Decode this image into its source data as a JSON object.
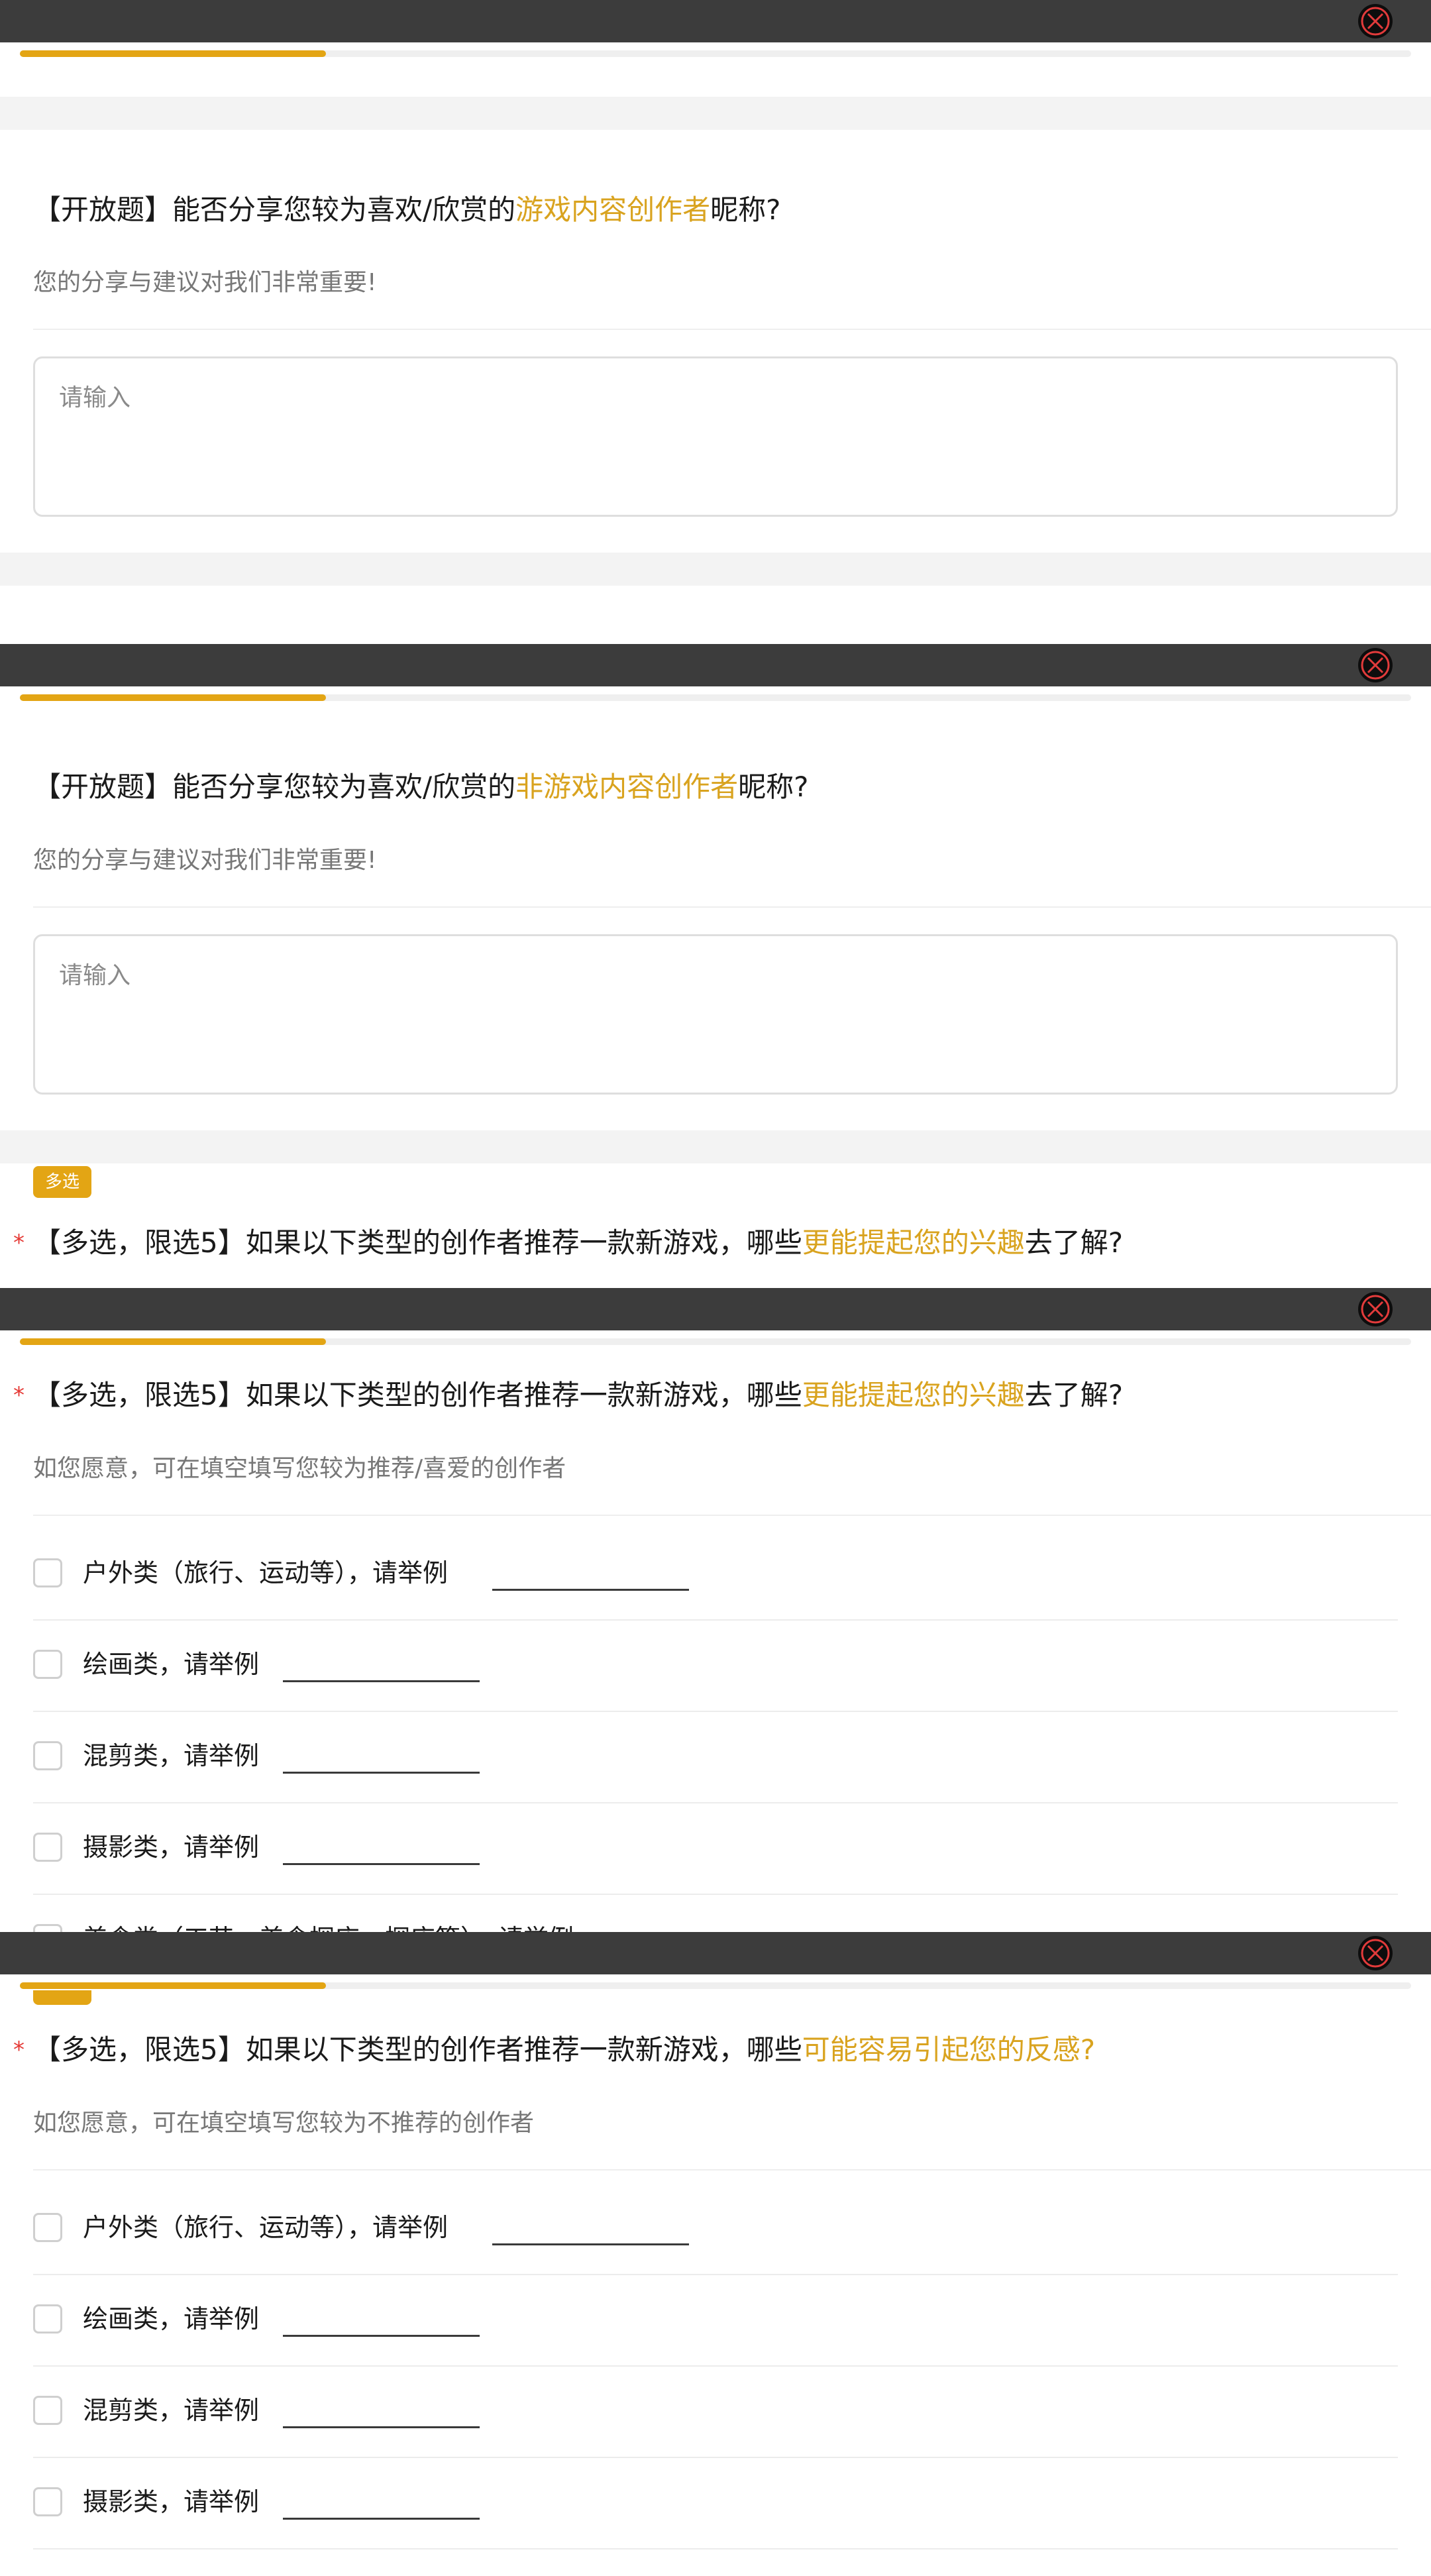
{
  "frames": [
    {
      "progress_pct": 22
    },
    {
      "progress_pct": 22
    },
    {
      "progress_pct": 22
    },
    {
      "progress_pct": 22
    }
  ],
  "q1": {
    "prefix": "【开放题】能否分享您较为喜欢/欣赏的",
    "highlight": "游戏内容创作者",
    "suffix": "昵称?",
    "subtitle": "您的分享与建议对我们非常重要!",
    "placeholder": "请输入"
  },
  "q2": {
    "prefix": "【开放题】能否分享您较为喜欢/欣赏的",
    "highlight": "非游戏内容创作者",
    "suffix": "昵称?",
    "subtitle": "您的分享与建议对我们非常重要!",
    "placeholder": "请输入"
  },
  "q3": {
    "badge": "多选",
    "required_mark": "*",
    "prefix": "【多选，限选5】如果以下类型的创作者推荐一款新游戏，哪些",
    "highlight": "更能提起您的兴趣",
    "suffix": "去了解?",
    "subtitle": "如您愿意，可在填空填写您较为推荐/喜爱的创作者",
    "options": [
      "户外类（旅行、运动等），请举例",
      "绘画类，请举例",
      "混剪类，请举例",
      "摄影类，请举例"
    ],
    "partial_option": "美食类（工艺、美食探店、探店等），请举例"
  },
  "q4": {
    "required_mark": "*",
    "prefix": "【多选，限选5】如果以下类型的创作者推荐一款新游戏，哪些",
    "highlight": "可能容易引起您的反感?",
    "suffix": "",
    "subtitle": "如您愿意，可在填空填写您较为不推荐的创作者",
    "options": [
      "户外类（旅行、运动等），请举例",
      "绘画类，请举例",
      "混剪类，请举例",
      "摄影类，请举例"
    ]
  },
  "colors": {
    "accent": "#e3a514",
    "highlight_text": "#d9a31f",
    "required": "#e53935",
    "top_bar": "#3c3c3c"
  },
  "icons": {
    "close": "close-x-icon",
    "checkbox": "checkbox-icon"
  }
}
